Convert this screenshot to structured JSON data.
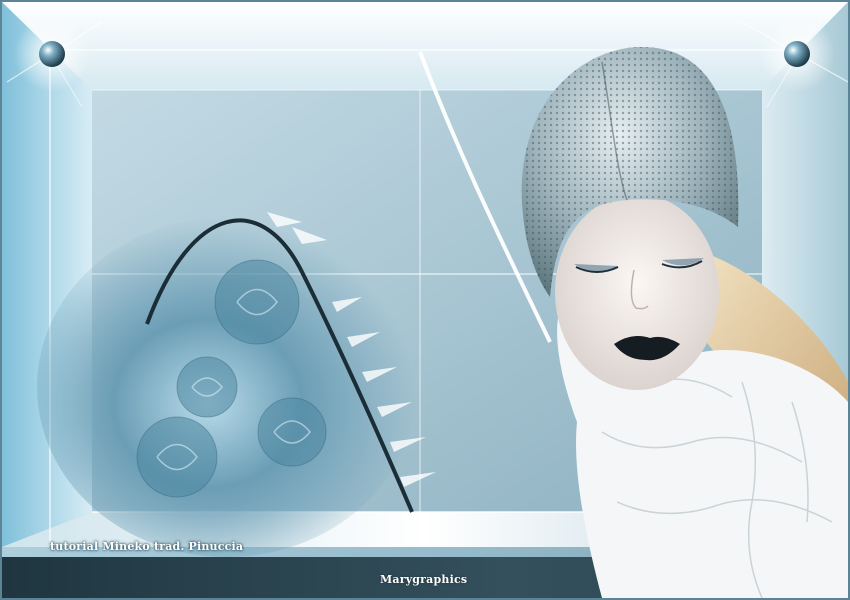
{
  "captions": {
    "tutorial": "tutorial Mineko trad. Pinuccia",
    "signature": "Marygraphics"
  },
  "colors": {
    "frame_light": "#e6f3f9",
    "frame_mid": "#9cc3d3",
    "frame_dark": "#2e4a56",
    "rose_blue": "#5f93ab",
    "accent_white": "#ffffff"
  }
}
